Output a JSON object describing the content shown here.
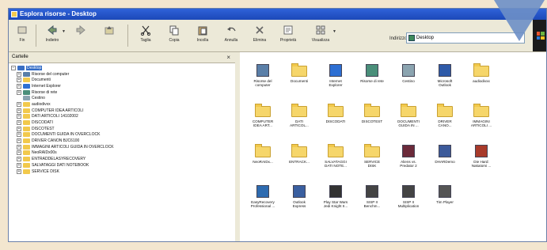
{
  "window": {
    "title": "Esplora risorse - Desktop"
  },
  "toolbar": {
    "buttons": [
      {
        "label": "Fin"
      },
      {
        "label": "Indietro"
      },
      {
        "label": ""
      },
      {
        "label": ""
      },
      {
        "label": "Taglia"
      },
      {
        "label": "Copia"
      },
      {
        "label": "Incolla"
      },
      {
        "label": "Annulla"
      },
      {
        "label": "Elimina"
      },
      {
        "label": "Proprietà"
      },
      {
        "label": "Visualizza"
      }
    ],
    "address_label": "Indirizzo",
    "address_value": "Desktop"
  },
  "left_pane": {
    "title": "Cartelle",
    "close": "×",
    "tree": [
      {
        "label": "Desktop",
        "expanded": true,
        "selected": true,
        "icon": "desktop-icon",
        "color": "#3a6fc4"
      },
      {
        "label": "Risorse del computer",
        "icon": "computer-icon",
        "color": "#5a7fa8"
      },
      {
        "label": "Documenti",
        "icon": "documents-icon",
        "color": "#f2c94c"
      },
      {
        "label": "Internet Explorer",
        "icon": "ie-icon",
        "color": "#2d6fd3"
      },
      {
        "label": "Risorse di rete",
        "icon": "network-icon",
        "color": "#4a8f7a"
      },
      {
        "label": "Cestino",
        "icon": "recycle-bin-icon",
        "color": "#8ba4b0"
      },
      {
        "label": "audiodivxx",
        "icon": "folder-icon",
        "color": "#f2c94c"
      },
      {
        "label": "COMPUTER IDEA ARTICOLI",
        "icon": "folder-icon",
        "color": "#f2c94c"
      },
      {
        "label": "DATI ARTICOLI 14102002",
        "icon": "folder-icon",
        "color": "#f2c94c"
      },
      {
        "label": "DISCODATI",
        "icon": "folder-icon",
        "color": "#f2c94c"
      },
      {
        "label": "DISCOTEST",
        "icon": "folder-icon",
        "color": "#f2c94c"
      },
      {
        "label": "DOCUMENTI GUIDA IN OVERCLOCK",
        "icon": "folder-icon",
        "color": "#f2c94c"
      },
      {
        "label": "DRIVER CANON BJC6100",
        "icon": "folder-icon",
        "color": "#f2c94c"
      },
      {
        "label": "IMMAGINI ARTICOLI GUIDA IN OVERCLOCK",
        "icon": "folder-icon",
        "color": "#f2c94c"
      },
      {
        "label": "NeoRAIDx00s",
        "icon": "folder-icon",
        "color": "#f2c94c"
      },
      {
        "label": "ENTRADDELASYRECOVERY",
        "icon": "folder-icon",
        "color": "#f2c94c"
      },
      {
        "label": "SALVATAGGI DATI NOTEBOOK",
        "icon": "folder-icon",
        "color": "#f2c94c"
      },
      {
        "label": "SERVICE DISK",
        "icon": "folder-icon",
        "color": "#f2c94c"
      }
    ]
  },
  "right_pane": {
    "items": [
      {
        "label": "Risorse del\ncomputer",
        "icon": "computer-icon",
        "color": "#5a7fa8"
      },
      {
        "label": "Documenti",
        "icon": "folder-icon",
        "color": "#f6d66a"
      },
      {
        "label": "Internet\nExplorer",
        "icon": "ie-icon",
        "color": "#2d6fd3"
      },
      {
        "label": "Risorse di rete",
        "icon": "network-icon",
        "color": "#4a8f7a"
      },
      {
        "label": "Cestino",
        "icon": "recycle-bin-icon",
        "color": "#8ba4b0"
      },
      {
        "label": "Microsoft\nOutlook",
        "icon": "outlook-icon",
        "color": "#2e5aa8"
      },
      {
        "label": "audiodivxx",
        "icon": "folder-icon",
        "color": "#f6d66a"
      },
      {
        "label": "COMPUTER\nIDEA ART...",
        "icon": "folder-icon",
        "color": "#f6d66a"
      },
      {
        "label": "DATI\nARTICOL...",
        "icon": "folder-icon",
        "color": "#f6d66a"
      },
      {
        "label": "DISCODATI",
        "icon": "folder-icon",
        "color": "#f6d66a"
      },
      {
        "label": "DISCOTEST",
        "icon": "folder-icon",
        "color": "#f6d66a"
      },
      {
        "label": "DOCUMENTI\nGUIDA IN ...",
        "icon": "folder-icon",
        "color": "#f6d66a"
      },
      {
        "label": "DRIVER\nCANO...",
        "icon": "folder-icon",
        "color": "#f6d66a"
      },
      {
        "label": "IMMAGINI\nARTICOLI ...",
        "icon": "folder-icon",
        "color": "#f6d66a"
      },
      {
        "label": "NeoRAIDx...",
        "icon": "folder-icon",
        "color": "#f6d66a"
      },
      {
        "label": "ENTRACK...",
        "icon": "folder-icon",
        "color": "#f6d66a"
      },
      {
        "label": "SALVATAGGI\nDATI NOTE...",
        "icon": "folder-icon",
        "color": "#f6d66a"
      },
      {
        "label": "SERVICE\nDISK",
        "icon": "folder-icon",
        "color": "#f6d66a"
      },
      {
        "label": "Aliens vs.\nPredator 2",
        "icon": "game-icon",
        "color": "#6b2a3a"
      },
      {
        "label": "DHARDemo",
        "icon": "app-icon",
        "color": "#3c5a9a"
      },
      {
        "label": "Die Hard:\nNakatomi ...",
        "icon": "game-icon",
        "color": "#a83a2a"
      },
      {
        "label": "EasyRecovery\nProfessional ...",
        "icon": "recovery-icon",
        "color": "#2e6bb0"
      },
      {
        "label": "Outlook\nExpress",
        "icon": "outlook-express-icon",
        "color": "#3a5fa0"
      },
      {
        "label": "Play Star Wars\nJedi Knight II...",
        "icon": "game-icon",
        "color": "#333333"
      },
      {
        "label": "SISP II\nBenchm...",
        "icon": "benchmark-icon",
        "color": "#444444"
      },
      {
        "label": "SISP II\nMultiplication",
        "icon": "benchmark-icon",
        "color": "#444444"
      },
      {
        "label": "Tim Player",
        "icon": "player-icon",
        "color": "#555555"
      }
    ]
  },
  "colors": {
    "titlebar": "#2f63d9",
    "selection": "#316ac5",
    "arrow": "#6d8fc7"
  }
}
